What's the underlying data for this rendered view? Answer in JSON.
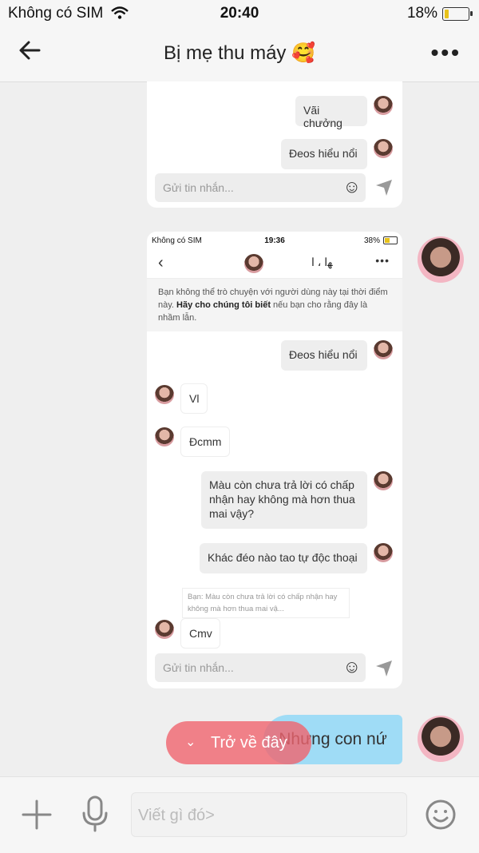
{
  "status_bar": {
    "carrier": "Không có SIM",
    "time": "20:40",
    "battery": "18%"
  },
  "header": {
    "title": "Bị mẹ thu máy 🥰"
  },
  "card1": {
    "messages": [
      "Vãi chưởng",
      "Đeos hiểu nổi"
    ],
    "input_placeholder": "Gửi tin nhắn..."
  },
  "screenshot": {
    "status": {
      "carrier": "Không có SIM",
      "time": "19:36",
      "battery": "38%"
    },
    "header_title": "ﻬا ، ا",
    "notice_prefix": "Bạn không thể trò chuyện với người dùng này tại thời điểm này. ",
    "notice_link": "Hãy cho chúng tôi biết",
    "notice_suffix": " nếu bạn cho rằng đây là nhầm lẫn.",
    "messages": {
      "m1": "Đeos hiểu nổi",
      "m2": "Vl",
      "m3": "Đcmm",
      "m4": "Màu còn chưa trả lời có chấp nhận hay không mà hơn thua mai vậy?",
      "m5": "Khác đéo nào tao tự độc thoại",
      "reply_quote": "Bạn: Màu còn chưa trả lời có chấp nhận hay không mà hơn thua mai vậ...",
      "m6": "Cmv"
    },
    "input_placeholder": "Gửi tin nhắn..."
  },
  "last_message": "Nhưng con nứ",
  "back_to_here": "Trở về đây",
  "composer": {
    "placeholder": "Viết gì đó>"
  }
}
